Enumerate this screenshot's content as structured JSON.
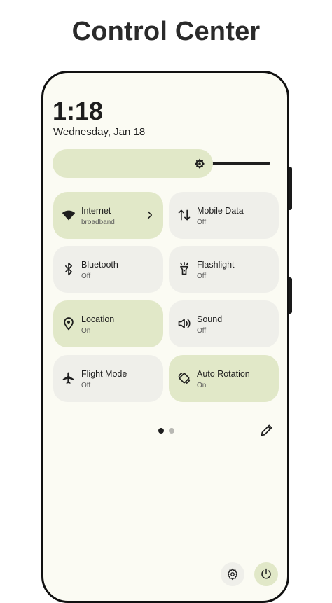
{
  "headline": "Control Center",
  "status": {
    "time": "1:18",
    "date": "Wednesday, Jan 18"
  },
  "colors": {
    "tile_on": "#e1e8c8",
    "tile_off": "#efefea",
    "background": "#fbfbf3"
  },
  "brightness": {
    "level": 0.7,
    "icon": "brightness-icon"
  },
  "tiles": [
    {
      "label": "Internet",
      "status": "broadband",
      "icon": "wifi-icon",
      "active": true,
      "has_chevron": true
    },
    {
      "label": "Mobile Data",
      "status": "Off",
      "icon": "mobile-data-icon",
      "active": false
    },
    {
      "label": "Bluetooth",
      "status": "Off",
      "icon": "bluetooth-icon",
      "active": false
    },
    {
      "label": "Flashlight",
      "status": "Off",
      "icon": "flashlight-icon",
      "active": false
    },
    {
      "label": "Location",
      "status": "On",
      "icon": "location-icon",
      "active": true
    },
    {
      "label": "Sound",
      "status": "Off",
      "icon": "sound-icon",
      "active": false
    },
    {
      "label": "Flight Mode",
      "status": "Off",
      "icon": "airplane-icon",
      "active": false
    },
    {
      "label": "Auto Rotation",
      "status": "On",
      "icon": "auto-rotate-icon",
      "active": true
    }
  ],
  "pager": {
    "pages": 2,
    "current": 1
  },
  "footer": {
    "settings_icon": "gear-icon",
    "power_icon": "power-icon"
  }
}
